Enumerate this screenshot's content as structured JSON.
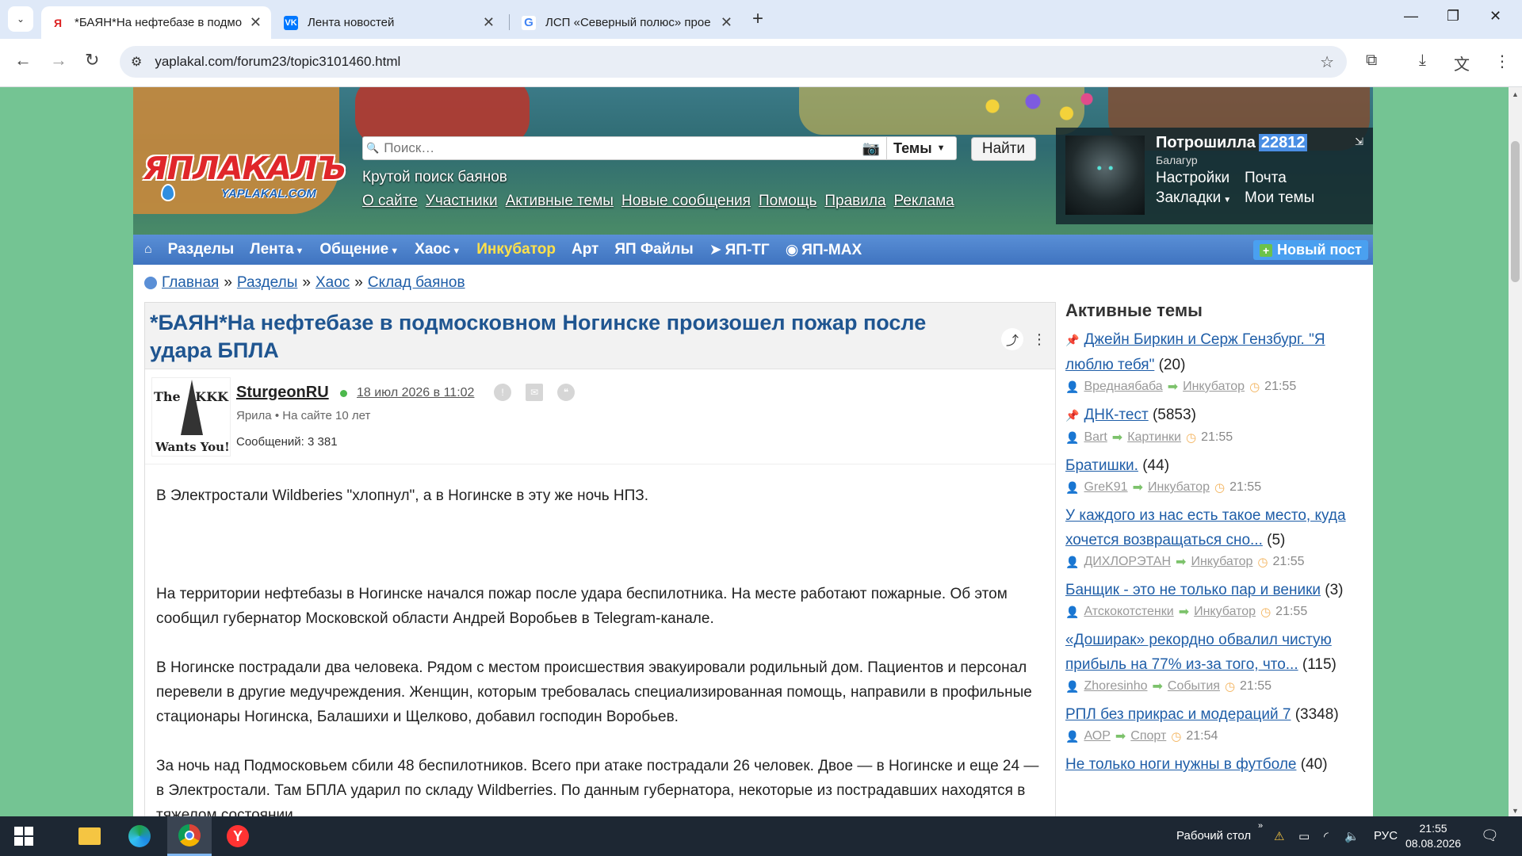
{
  "browser": {
    "tabs": [
      {
        "title": "*БАЯН*На нефтебазе в подмо",
        "favicon": "yaplakal",
        "active": true
      },
      {
        "title": "Лента новостей",
        "favicon": "vk",
        "active": false
      },
      {
        "title": "ЛСП «Северный полюс» прое",
        "favicon": "google",
        "active": false
      }
    ],
    "url": "yaplakal.com/forum23/topic3101460.html"
  },
  "site": {
    "logo_main": "ЯПЛАКАЛЪ",
    "logo_sub": "YAPLAKAL.COM",
    "search_placeholder": "Поиск…",
    "search_scope": "Темы",
    "search_button": "Найти",
    "tagline": "Крутой поиск баянов",
    "top_links": [
      "О сайте",
      "Участники",
      "Активные темы",
      "Новые сообщения",
      "Помощь",
      "Правила",
      "Реклама"
    ],
    "user": {
      "name": "Потрошилла",
      "karma": "22812",
      "rank": "Балагур",
      "links": [
        "Настройки",
        "Почта",
        "Закладки",
        "Мои темы"
      ]
    },
    "nav": [
      "Разделы",
      "Лента",
      "Общение",
      "Хаос",
      "Инкубатор",
      "Арт",
      "ЯП Файлы",
      "ЯП-ТГ",
      "ЯП-MAX"
    ],
    "new_post": "Новый пост"
  },
  "breadcrumbs": [
    "Главная",
    "Разделы",
    "Хаос",
    "Склад баянов"
  ],
  "post": {
    "title": "*БАЯН*На нефтебазе в подмосковном Ногинске произошел пожар после удара БПЛА",
    "author": "SturgeonRU",
    "date": "18 июл 2026 в 11:02",
    "meta": "Ярила  •  На сайте 10 лет",
    "messages": "Сообщений: 3 381",
    "avatar_text": {
      "top_left": "The",
      "top_right": "KKK",
      "bottom": "Wants You!"
    },
    "paragraphs": [
      "В Электростали Wildberies \"хлопнул\", а в Ногинске в эту же ночь НПЗ.",
      "",
      "На территории нефтебазы в Ногинске начался пожар после удара беспилотника. На месте работают пожарные. Об этом сообщил губернатор Московской области Андрей Воробьев в Telegram-канале.",
      "В Ногинске пострадали два человека. Рядом с местом происшествия эвакуировали родильный дом. Пациентов и персонал перевели в другие медучреждения. Женщин, которым требовалась специализированная помощь, направили в профильные стационары Ногинска, Балашихи и Щелково, добавил господин Воробьев.",
      "За ночь над Подмосковьем сбили 48 беспилотников. Всего при атаке пострадали 26 человек. Двое — в Ногинске и еще 24 — в Электростали. Там БПЛА ударил по складу Wildberries. По данным губернатора, некоторые из пострадавших находятся в тяжелом состоянии."
    ]
  },
  "sidebar": {
    "title": "Активные темы",
    "topics": [
      {
        "pinned": true,
        "title": "Джейн Биркин и Серж Гензбург. \"Я люблю тебя\"",
        "count": "(20)",
        "user": "Вреднаябаба",
        "section": "Инкубатор",
        "time": "21:55"
      },
      {
        "pinned": true,
        "title": "ДНК-тест",
        "count": "(5853)",
        "user": "Bart",
        "section": "Картинки",
        "time": "21:55"
      },
      {
        "pinned": false,
        "title": "Братишки.",
        "count": "(44)",
        "user": "GreK91",
        "section": "Инкубатор",
        "time": "21:55"
      },
      {
        "pinned": false,
        "title": "У каждого из нас есть такое место, куда хочется возвращаться сно...",
        "count": "(5)",
        "user": "ДИХЛОРЭТАН",
        "section": "Инкубатор",
        "time": "21:55"
      },
      {
        "pinned": false,
        "title": "Банщик - это не только пар и веники",
        "count": "(3)",
        "user": "Атскокотстенки",
        "section": "Инкубатор",
        "time": "21:55"
      },
      {
        "pinned": false,
        "title": "«Доширак» рекордно обвалил чистую прибыль на 77% из-за того, что...",
        "count": "(115)",
        "user": "Zhoresinho",
        "section": "События",
        "time": "21:55"
      },
      {
        "pinned": false,
        "title": "РПЛ без прикрас и модераций 7",
        "count": "(3348)",
        "user": "АОР",
        "section": "Спорт",
        "time": "21:54"
      },
      {
        "pinned": false,
        "title": "Не только ноги нужны в футболе",
        "count": "(40)",
        "user": "",
        "section": "",
        "time": ""
      }
    ]
  },
  "taskbar": {
    "desktop_label": "Рабочий стол",
    "lang": "РУС",
    "time": "21:55",
    "date": "08.08.2026"
  }
}
